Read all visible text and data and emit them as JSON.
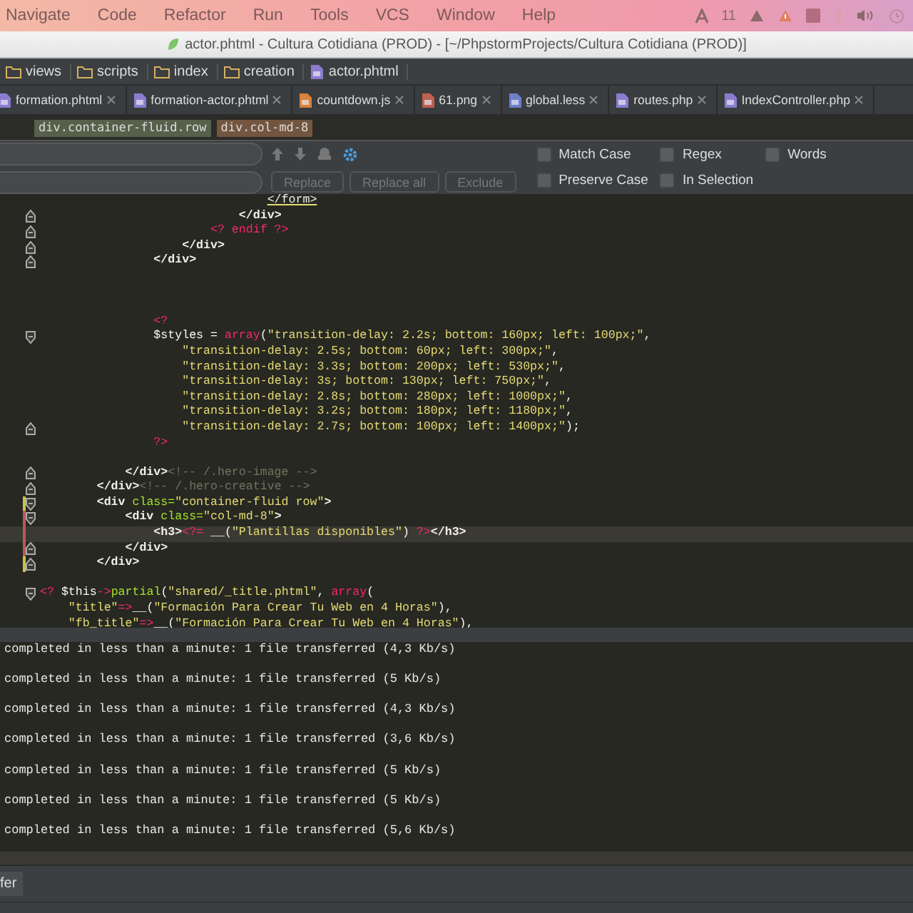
{
  "menu_bar": {
    "items": [
      "Navigate",
      "Code",
      "Refactor",
      "Run",
      "Tools",
      "VCS",
      "Window",
      "Help"
    ],
    "tray_count": "11"
  },
  "window": {
    "title": "actor.phtml - Cultura Cotidiana (PROD) - [~/PhpstormProjects/Cultura Cotidiana (PROD)]"
  },
  "breadcrumb": [
    {
      "label": "views",
      "kind": "folder"
    },
    {
      "label": "scripts",
      "kind": "folder"
    },
    {
      "label": "index",
      "kind": "folder"
    },
    {
      "label": "creation",
      "kind": "folder"
    },
    {
      "label": "actor.phtml",
      "kind": "file"
    }
  ],
  "tabs": [
    {
      "label": "formation.phtml",
      "kind": "php"
    },
    {
      "label": "formation-actor.phtml",
      "kind": "php"
    },
    {
      "label": "countdown.js",
      "kind": "js"
    },
    {
      "label": "61.png",
      "kind": "image"
    },
    {
      "label": "global.less",
      "kind": "less"
    },
    {
      "label": "routes.php",
      "kind": "php"
    },
    {
      "label": "IndexController.php",
      "kind": "php"
    }
  ],
  "structure": [
    {
      "label": "div.container-fluid.row",
      "kind": "outer"
    },
    {
      "label": "div.col-md-8",
      "kind": "inner"
    }
  ],
  "find_bar": {
    "options": [
      {
        "label": "Match Case",
        "checked": false
      },
      {
        "label": "Regex",
        "checked": false
      },
      {
        "label": "Words",
        "checked": false
      },
      {
        "label": "Preserve Case",
        "checked": false
      },
      {
        "label": "In Selection",
        "checked": false
      }
    ],
    "buttons": [
      {
        "label": "Replace",
        "disabled": true
      },
      {
        "label": "Replace all",
        "disabled": true
      },
      {
        "label": "Exclude",
        "disabled": true
      }
    ]
  },
  "code_lines": [
    {
      "current": false,
      "fold_open": false,
      "fold_close": false,
      "segs": [
        {
          "kind": "tagu",
          "text": "                                </form>"
        }
      ]
    },
    {
      "current": false,
      "fold_open": false,
      "fold_close": true,
      "segs": [
        {
          "kind": "tag",
          "text": "                            </div>"
        }
      ]
    },
    {
      "current": false,
      "fold_open": false,
      "fold_close": true,
      "segs": [
        {
          "kind": "php",
          "text": "                        <? endif ?>"
        }
      ]
    },
    {
      "current": false,
      "fold_open": false,
      "fold_close": true,
      "segs": [
        {
          "kind": "tag",
          "text": "                    </div>"
        }
      ]
    },
    {
      "current": false,
      "fold_open": false,
      "fold_close": true,
      "segs": [
        {
          "kind": "tag",
          "text": "                </div>"
        }
      ]
    },
    {
      "current": false,
      "fold_open": false,
      "fold_close": false
    },
    {
      "current": false,
      "fold_open": false,
      "fold_close": false
    },
    {
      "current": false,
      "fold_open": false,
      "fold_close": false
    },
    {
      "current": false,
      "fold_open": false,
      "fold_close": false,
      "segs": [
        {
          "kind": "php",
          "text": "                <?"
        }
      ]
    },
    {
      "current": false,
      "fold_open": true,
      "fold_close": false,
      "segs": [
        {
          "kind": "plain",
          "text": "                $styles = "
        },
        {
          "kind": "php",
          "text": "array"
        },
        {
          "kind": "plain",
          "text": "("
        },
        {
          "kind": "str",
          "text": "\"transition-delay: 2.2s; bottom: 160px; left: 100px;\""
        },
        {
          "kind": "plain",
          "text": ","
        }
      ]
    },
    {
      "current": false,
      "fold_open": false,
      "fold_close": false,
      "segs": [
        {
          "kind": "str",
          "text": "                    \"transition-delay: 2.5s; bottom: 60px; left: 300px;\""
        },
        {
          "kind": "plain",
          "text": ","
        }
      ]
    },
    {
      "current": false,
      "fold_open": false,
      "fold_close": false,
      "segs": [
        {
          "kind": "str",
          "text": "                    \"transition-delay: 3.3s; bottom: 200px; left: 530px;\""
        },
        {
          "kind": "plain",
          "text": ","
        }
      ]
    },
    {
      "current": false,
      "fold_open": false,
      "fold_close": false,
      "segs": [
        {
          "kind": "str",
          "text": "                    \"transition-delay: 3s; bottom: 130px; left: 750px;\""
        },
        {
          "kind": "plain",
          "text": ","
        }
      ]
    },
    {
      "current": false,
      "fold_open": false,
      "fold_close": false,
      "segs": [
        {
          "kind": "str",
          "text": "                    \"transition-delay: 2.8s; bottom: 280px; left: 1000px;\""
        },
        {
          "kind": "plain",
          "text": ","
        }
      ]
    },
    {
      "current": false,
      "fold_open": false,
      "fold_close": false,
      "segs": [
        {
          "kind": "str",
          "text": "                    \"transition-delay: 3.2s; bottom: 180px; left: 1180px;\""
        },
        {
          "kind": "plain",
          "text": ","
        }
      ]
    },
    {
      "current": false,
      "fold_open": false,
      "fold_close": true,
      "segs": [
        {
          "kind": "str",
          "text": "                    \"transition-delay: 2.7s; bottom: 100px; left: 1400px;\""
        },
        {
          "kind": "plain",
          "text": ");"
        }
      ]
    },
    {
      "current": false,
      "fold_open": false,
      "fold_close": false,
      "segs": [
        {
          "kind": "php",
          "text": "                ?>"
        }
      ]
    },
    {
      "current": false,
      "fold_open": false,
      "fold_close": false
    },
    {
      "current": false,
      "fold_open": false,
      "fold_close": true,
      "segs": [
        {
          "kind": "tag",
          "text": "            </div>"
        },
        {
          "kind": "comment",
          "text": "<!-- /.hero-image -->"
        }
      ]
    },
    {
      "current": false,
      "fold_open": false,
      "fold_close": true,
      "segs": [
        {
          "kind": "tag",
          "text": "        </div>"
        },
        {
          "kind": "comment",
          "text": "<!-- /.hero-creative -->"
        }
      ]
    },
    {
      "current": false,
      "fold_open": true,
      "fold_close": false,
      "color": "#c8c24a",
      "segs": [
        {
          "kind": "tag",
          "text": "        <div "
        },
        {
          "kind": "attr",
          "text": "class="
        },
        {
          "kind": "str",
          "text": "\"container-fluid row\""
        },
        {
          "kind": "tag",
          "text": ">"
        }
      ]
    },
    {
      "current": false,
      "fold_open": true,
      "fold_close": false,
      "color": "#b85a5a",
      "segs": [
        {
          "kind": "tag",
          "text": "            <div "
        },
        {
          "kind": "attr",
          "text": "class="
        },
        {
          "kind": "str",
          "text": "\"col-md-8\""
        },
        {
          "kind": "tag",
          "text": ">"
        }
      ]
    },
    {
      "current": true,
      "fold_open": false,
      "fold_close": false,
      "color": "#b85a5a",
      "segs": [
        {
          "kind": "tag",
          "text": "                <h3>"
        },
        {
          "kind": "php",
          "text": "<?="
        },
        {
          "kind": "plain",
          "text": " __("
        },
        {
          "kind": "str",
          "text": "\"Plantillas disponibles\""
        },
        {
          "kind": "plain",
          "text": ") "
        },
        {
          "kind": "php",
          "text": "?>"
        },
        {
          "kind": "tag",
          "text": "</h3>"
        }
      ]
    },
    {
      "current": false,
      "fold_open": false,
      "fold_close": true,
      "color": "#b85a5a",
      "segs": [
        {
          "kind": "tag",
          "text": "            </div>"
        }
      ]
    },
    {
      "current": false,
      "fold_open": false,
      "fold_close": true,
      "color": "#c8c24a",
      "segs": [
        {
          "kind": "tag",
          "text": "        </div>"
        }
      ]
    },
    {
      "current": false,
      "fold_open": false,
      "fold_close": false
    },
    {
      "current": false,
      "fold_open": true,
      "fold_close": false,
      "segs": [
        {
          "kind": "php",
          "text": "<?"
        },
        {
          "kind": "plain",
          "text": " $this"
        },
        {
          "kind": "php",
          "text": "->"
        },
        {
          "kind": "attr",
          "text": "partial"
        },
        {
          "kind": "plain",
          "text": "("
        },
        {
          "kind": "str",
          "text": "\"shared/_title.phtml\""
        },
        {
          "kind": "plain",
          "text": ", "
        },
        {
          "kind": "php",
          "text": "array"
        },
        {
          "kind": "plain",
          "text": "("
        }
      ]
    },
    {
      "current": false,
      "fold_open": false,
      "fold_close": false,
      "segs": [
        {
          "kind": "str",
          "text": "    \"title\""
        },
        {
          "kind": "php",
          "text": "=>"
        },
        {
          "kind": "plain",
          "text": "__("
        },
        {
          "kind": "str",
          "text": "\"Formación Para Crear Tu Web en 4 Horas\""
        },
        {
          "kind": "plain",
          "text": "),"
        }
      ]
    },
    {
      "current": false,
      "fold_open": false,
      "fold_close": false,
      "segs": [
        {
          "kind": "str",
          "text": "    \"fb_title\""
        },
        {
          "kind": "php",
          "text": "=>"
        },
        {
          "kind": "plain",
          "text": "__("
        },
        {
          "kind": "str",
          "text": "\"Formación Para Crear Tu Web en 4 Horas\""
        },
        {
          "kind": "plain",
          "text": "),"
        }
      ]
    }
  ],
  "console_lines": [
    "completed in less than a minute: 1 file transferred (4,3 Kb/s)",
    "completed in less than a minute: 1 file transferred (5 Kb/s)",
    "completed in less than a minute: 1 file transferred (4,3 Kb/s)",
    "completed in less than a minute: 1 file transferred (3,6 Kb/s)",
    "completed in less than a minute: 1 file transferred (5 Kb/s)",
    "completed in less than a minute: 1 file transferred (5 Kb/s)",
    "completed in less than a minute: 1 file transferred (5,6 Kb/s)"
  ],
  "tool_tab": "fer"
}
